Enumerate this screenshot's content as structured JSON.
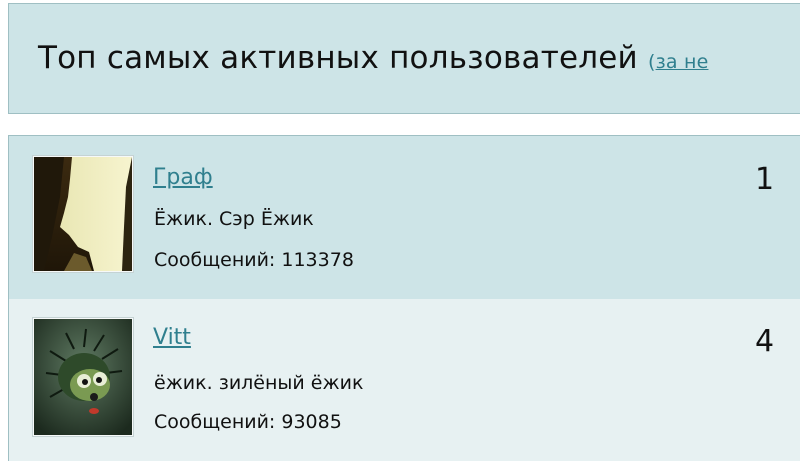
{
  "header": {
    "title": "Топ самых активных пользователей",
    "period_open": "(",
    "period_link": "за не"
  },
  "users": [
    {
      "name": "Граф",
      "status": "Ёжик. Сэр Ёжик",
      "posts": "Сообщений: 113378",
      "rank": "1",
      "avatar_icon": "forest-light-avatar"
    },
    {
      "name": "Vitt",
      "status": "ёжик. зилёный ёжик",
      "posts": "Сообщений: 93085",
      "rank": "4",
      "avatar_icon": "green-hedgehog-avatar"
    }
  ],
  "colors": {
    "header_bg": "#cde4e7",
    "row1_bg": "#cde4e7",
    "row2_bg": "#e7f1f2",
    "border": "#9fbfc3",
    "link": "#2f7f8e"
  }
}
